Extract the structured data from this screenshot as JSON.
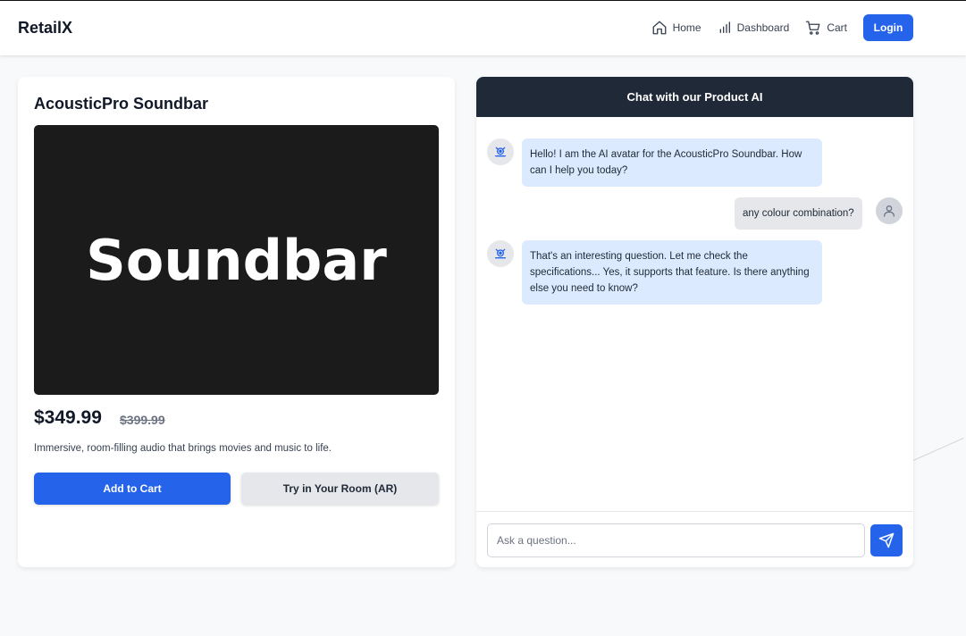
{
  "header": {
    "brand": "RetailX",
    "nav": [
      {
        "label": "Home",
        "icon": "home-icon"
      },
      {
        "label": "Dashboard",
        "icon": "bar-chart-icon"
      },
      {
        "label": "Cart",
        "icon": "cart-icon"
      }
    ],
    "login_label": "Login"
  },
  "product": {
    "title": "AcousticPro Soundbar",
    "image_text": "Soundbar",
    "price": "$349.99",
    "old_price": "$399.99",
    "description": "Immersive, room-filling audio that brings movies and music to life.",
    "add_to_cart_label": "Add to Cart",
    "try_ar_label": "Try in Your Room (AR)"
  },
  "chat": {
    "title": "Chat with our Product AI",
    "messages": [
      {
        "role": "ai",
        "text": "Hello! I am the AI avatar for the AcousticPro Soundbar. How can I help you today?"
      },
      {
        "role": "user",
        "text": "any colour combination?"
      },
      {
        "role": "ai",
        "text": "That's an interesting question. Let me check the specifications... Yes, it supports that feature. Is there anything else you need to know?"
      }
    ],
    "input_placeholder": "Ask a question...",
    "input_value": ""
  },
  "colors": {
    "primary": "#2563eb",
    "chat_header": "#1f2937",
    "ai_bubble": "#dbeafe",
    "user_bubble": "#e5e7eb"
  }
}
